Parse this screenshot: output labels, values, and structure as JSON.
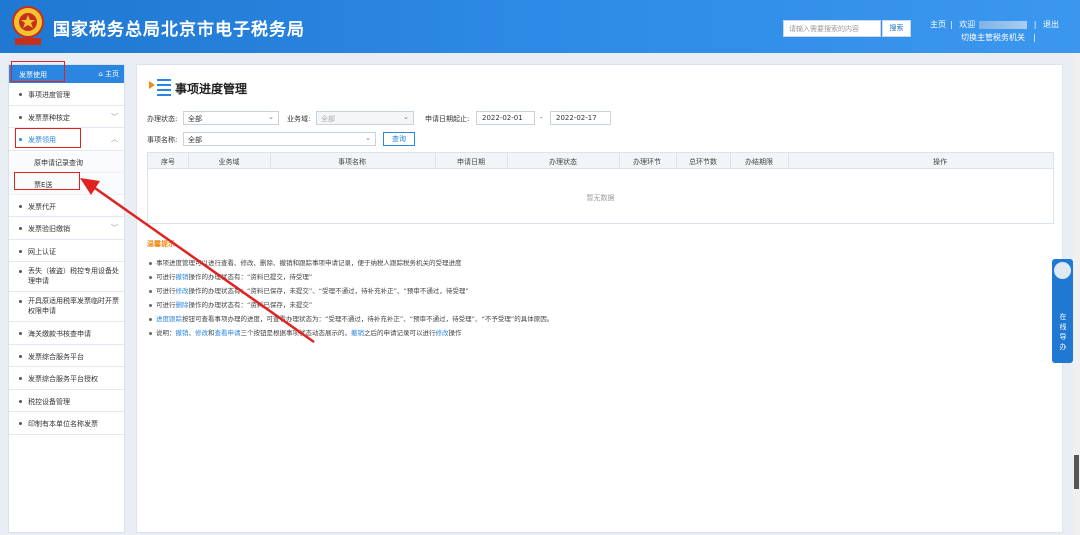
{
  "header": {
    "title": "国家税务总局北京市电子税务局",
    "search_placeholder": "请输入需要搜索的内容",
    "search_button": "搜索",
    "link_home": "主页",
    "link_welcome": "欢迎",
    "link_logout": "退出",
    "link_switch": "切换主管税务机关"
  },
  "sidebar": {
    "header_title": "发票使用",
    "home_link": "主页",
    "items": [
      {
        "label": "事项进度管理"
      },
      {
        "label": "发票票种核定"
      },
      {
        "label": "发票领用"
      },
      {
        "label": "发票代开"
      },
      {
        "label": "发票验旧缴销"
      },
      {
        "label": "网上认证"
      },
      {
        "label": "丢失（被盗）税控专用设备处理申请"
      },
      {
        "label": "开具原适用税率发票临时开票权限申请"
      },
      {
        "label": "海关缴款书核查申请"
      },
      {
        "label": "发票综合服务平台"
      },
      {
        "label": "发票综合服务平台授权"
      },
      {
        "label": "税控设备管理"
      },
      {
        "label": "印制有本单位名称发票"
      }
    ],
    "sub_items": [
      {
        "label": "原申请记录查询"
      },
      {
        "label": "票E送"
      }
    ]
  },
  "main": {
    "title": "事项进度管理",
    "filters": {
      "status_label": "办理状态:",
      "status_value": "全部",
      "domain_label": "业务域:",
      "domain_value": "全部",
      "date_label": "申请日期起止:",
      "date_from": "2022-02-01",
      "date_sep": "-",
      "date_to": "2022-02-17",
      "name_label": "事项名称:",
      "name_value": "全部",
      "query_button": "查询"
    },
    "table": {
      "columns": [
        "序号",
        "业务域",
        "事项名称",
        "申请日期",
        "办理状态",
        "办理环节",
        "总环节数",
        "办结期限",
        "操作"
      ],
      "empty_text": "暂无数据"
    },
    "tips_title": "温馨提示",
    "tips": [
      {
        "parts": [
          {
            "t": "事项进度管理可以进行查看、修改、删除、撤销和跟踪事项申请记录，便于纳税人跟踪税务机关的受理进度"
          }
        ]
      },
      {
        "parts": [
          {
            "t": "可进行"
          },
          {
            "t": "撤销",
            "c": "b"
          },
          {
            "t": "操作的办理状态有：“资料已提交，待受理”"
          }
        ]
      },
      {
        "parts": [
          {
            "t": "可进行"
          },
          {
            "t": "修改",
            "c": "b"
          },
          {
            "t": "操作的办理状态有：“资料已保存，未提交”、“受理不通过，待补充补正”、“预审不通过，待受理”"
          }
        ]
      },
      {
        "parts": [
          {
            "t": "可进行"
          },
          {
            "t": "删除",
            "c": "b"
          },
          {
            "t": "操作的办理状态有：“资料已保存，未提交”"
          }
        ]
      },
      {
        "parts": [
          {
            "t": "进度跟踪",
            "c": "b"
          },
          {
            "t": "按钮可查看事项办理的进度，可查看办理状态为：“受理不通过，待补充补正”、“预审不通过，待受理”、“不予受理”的具体原因。"
          }
        ]
      },
      {
        "parts": [
          {
            "t": "说明："
          },
          {
            "t": "撤销",
            "c": "b"
          },
          {
            "t": "、"
          },
          {
            "t": "修改",
            "c": "b"
          },
          {
            "t": "和"
          },
          {
            "t": "查看申请",
            "c": "b"
          },
          {
            "t": "三个按钮是根据事项状态动态展示的，"
          },
          {
            "t": "撤销",
            "c": "b"
          },
          {
            "t": "之后的申请记录可以进行"
          },
          {
            "t": "修改",
            "c": "b"
          },
          {
            "t": "操作"
          }
        ]
      }
    ]
  },
  "float_panel": {
    "label": "在线导办"
  },
  "colors": {
    "header_blue": "#1f78d1",
    "accent_blue": "#2a86e0",
    "annotation_red": "#e02222",
    "tip_orange": "#f08a1c"
  }
}
